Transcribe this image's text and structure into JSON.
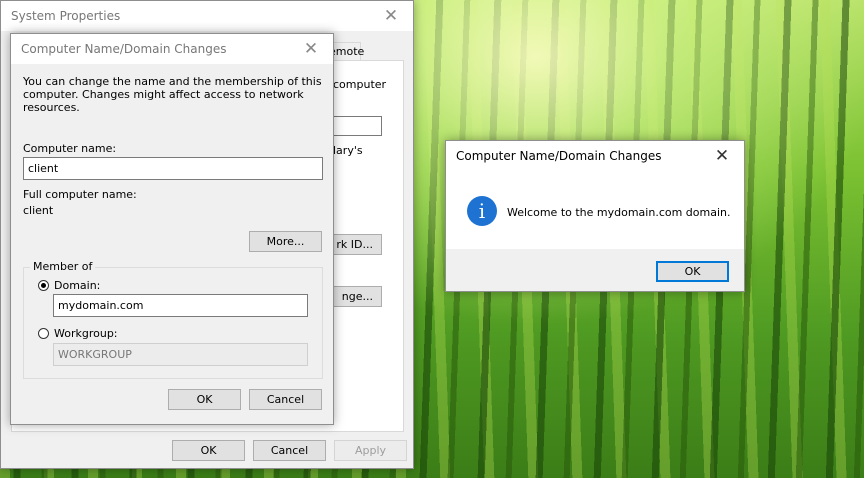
{
  "system_properties": {
    "title": "System Properties",
    "tab_remote": "emote",
    "frag_computer": "computer",
    "frag_ary": "lary's",
    "network_id_button": "rk ID...",
    "change_button": "nge...",
    "ok": "OK",
    "cancel": "Cancel",
    "apply": "Apply"
  },
  "name_dialog": {
    "title": "Computer Name/Domain Changes",
    "description": "You can change the name and the membership of this computer. Changes might affect access to network resources.",
    "computer_name_label": "Computer name:",
    "computer_name_value": "client",
    "full_name_label": "Full computer name:",
    "full_name_value": "client",
    "more_button": "More...",
    "member_of": "Member of",
    "domain_label": "Domain:",
    "domain_value": "mydomain.com",
    "workgroup_label": "Workgroup:",
    "workgroup_value": "WORKGROUP",
    "selected_membership": "domain",
    "ok": "OK",
    "cancel": "Cancel"
  },
  "message_box": {
    "title": "Computer Name/Domain Changes",
    "icon": "info-icon",
    "message": "Welcome to the mydomain.com domain.",
    "ok": "OK"
  },
  "colors": {
    "accent": "#0078d7",
    "info_icon": "#1e73d2"
  }
}
